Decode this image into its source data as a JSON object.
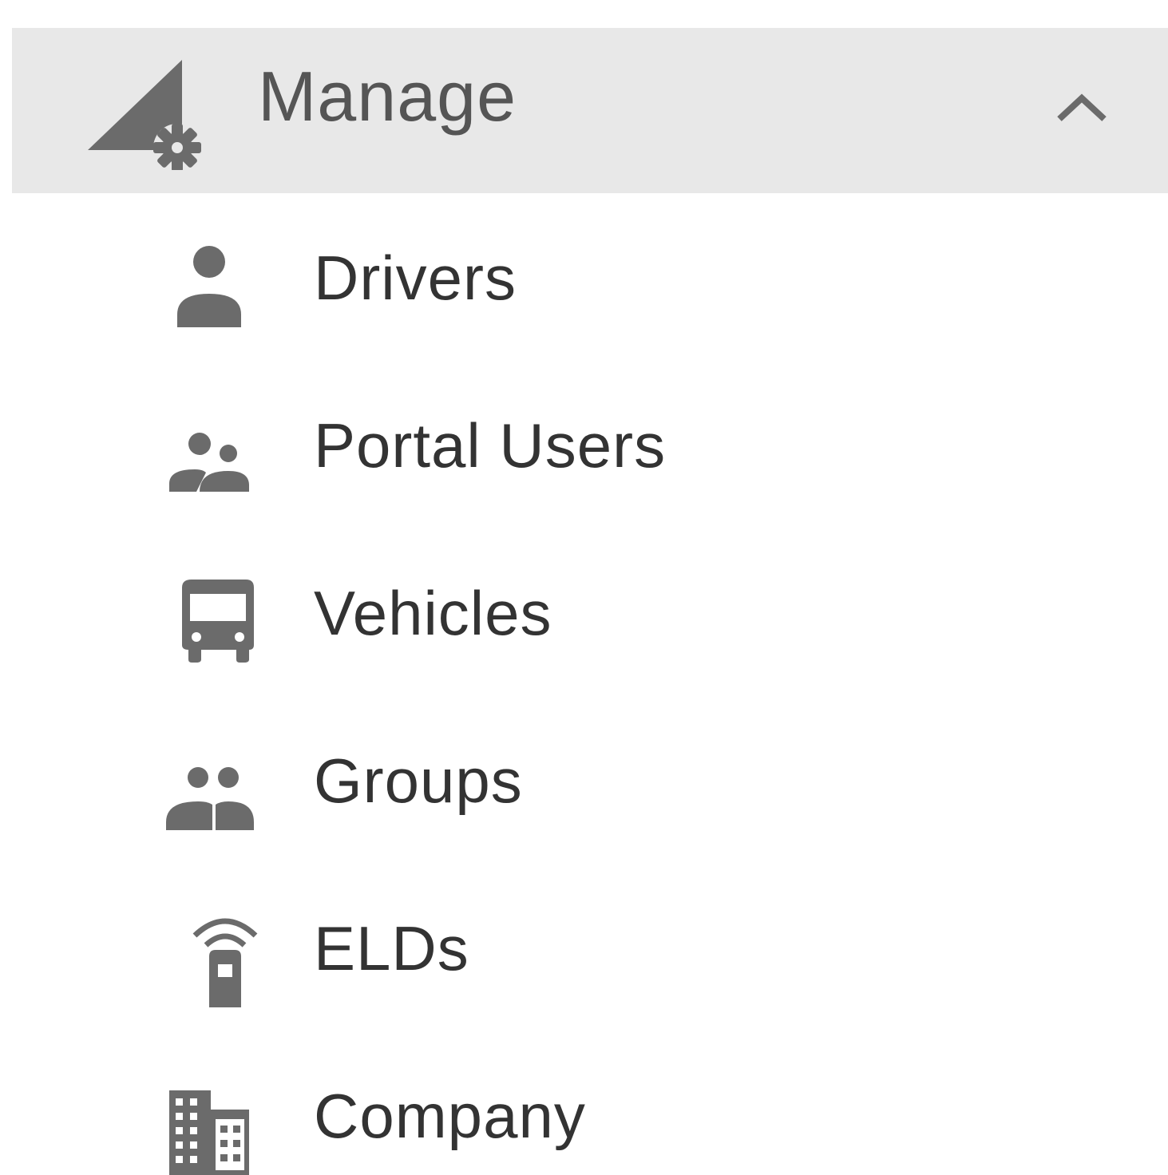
{
  "colors": {
    "header_background": "#e8e8e8",
    "icon_gray": "#6b6b6b",
    "header_text": "#555555",
    "item_text": "#333333"
  },
  "header": {
    "icon": "manage-gear-icon",
    "label": "Manage",
    "expanded_indicator": "chevron-up-icon"
  },
  "items": [
    {
      "label": "Drivers",
      "icon": "person-icon"
    },
    {
      "label": "Portal Users",
      "icon": "users-icon"
    },
    {
      "label": "Vehicles",
      "icon": "bus-icon"
    },
    {
      "label": "Groups",
      "icon": "group-icon"
    },
    {
      "label": "ELDs",
      "icon": "eld-device-icon"
    },
    {
      "label": "Company",
      "icon": "building-icon"
    }
  ]
}
